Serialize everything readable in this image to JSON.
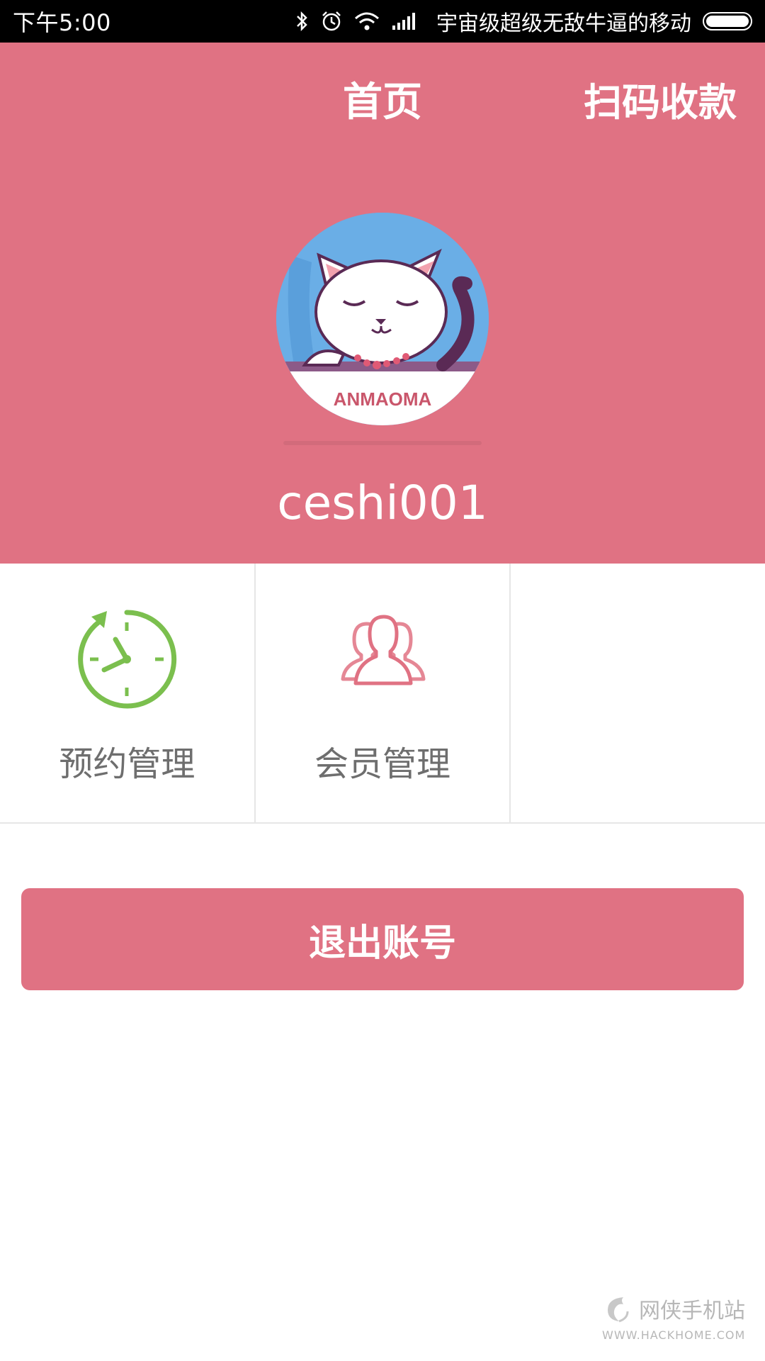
{
  "status_bar": {
    "time": "下午5:00",
    "carrier": "宇宙级超级无敌牛逼的移动",
    "icons": [
      "bluetooth-icon",
      "alarm-icon",
      "wifi-icon",
      "signal-icon",
      "battery-icon"
    ],
    "battery_level": 1.0
  },
  "header": {
    "title": "首页",
    "scan_pay": "扫码收款",
    "avatar_text": "ANMAOMA",
    "username": "ceshi001",
    "bg_color": "#e07283"
  },
  "grid": {
    "items": [
      {
        "label": "预约管理",
        "icon": "clock-icon",
        "color": "#7bbf4e"
      },
      {
        "label": "会员管理",
        "icon": "members-icon",
        "color": "#e07283"
      },
      {
        "label": "",
        "icon": ""
      }
    ]
  },
  "logout": {
    "label": "退出账号"
  },
  "watermark": {
    "name": "网侠手机站",
    "url": "WWW.HACKHOME.COM"
  }
}
